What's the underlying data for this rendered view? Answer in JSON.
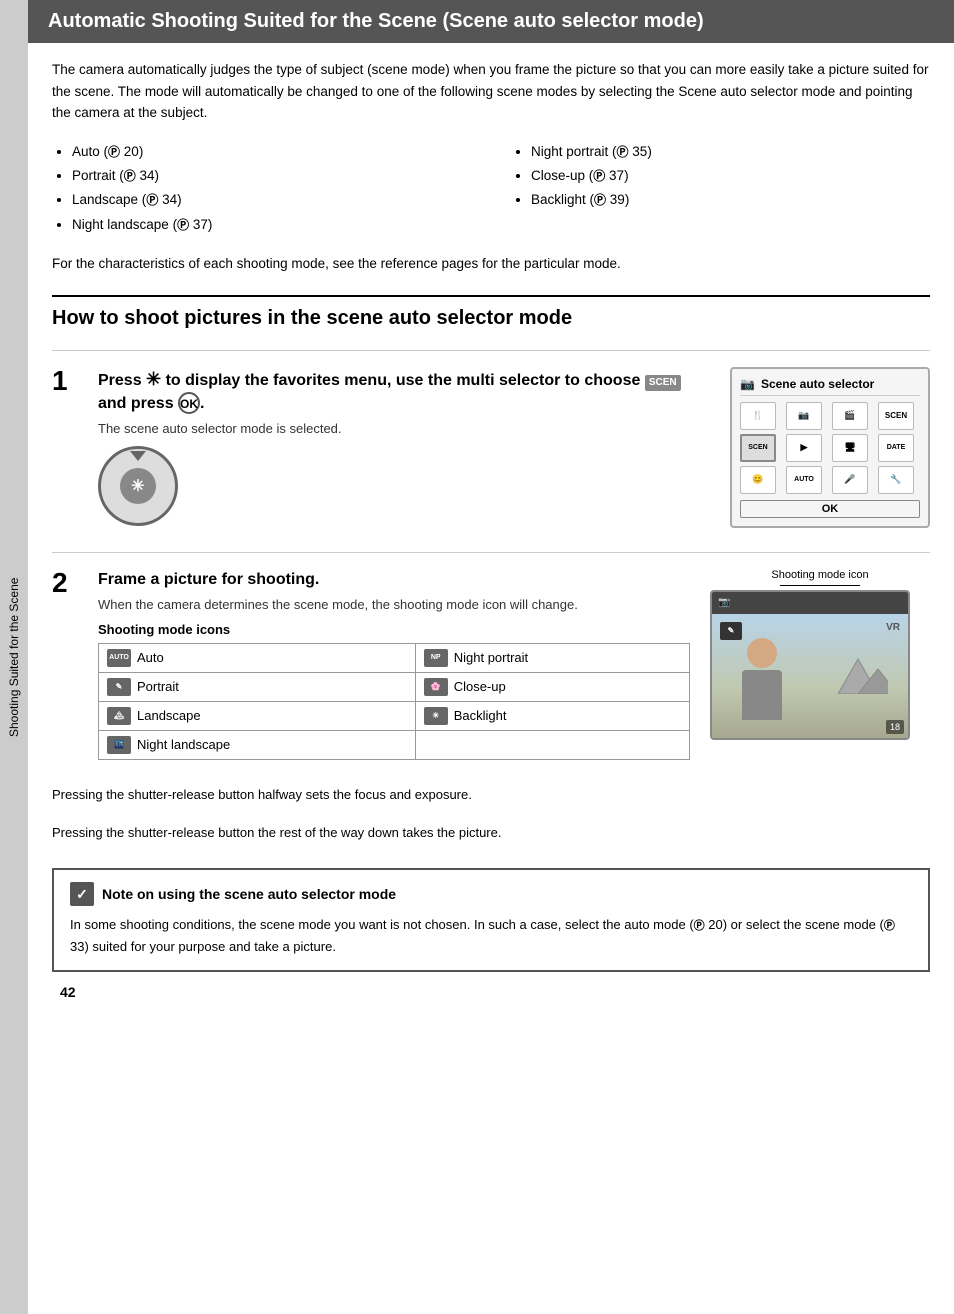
{
  "header": {
    "title": "Automatic Shooting Suited for the Scene (Scene auto selector mode)"
  },
  "intro": {
    "text": "The camera automatically judges the type of subject (scene mode) when you frame the picture so that you can more easily take a picture suited for the scene. The mode will automatically be changed to one of the following scene modes by selecting the Scene auto selector mode and pointing the camera at the subject."
  },
  "bullet_list_left": [
    "Auto (🔎 20)",
    "Portrait (🔎 34)",
    "Landscape (🔎 34)",
    "Night landscape (🔎 37)"
  ],
  "bullet_list_right": [
    "Night portrait (🔎 35)",
    "Close-up (🔎 37)",
    "Backlight (🔎 39)"
  ],
  "ref_text": "For the characteristics of each shooting mode, see the reference pages for the particular mode.",
  "section_heading": "How to shoot pictures in the scene auto selector mode",
  "step1": {
    "number": "1",
    "title": "Press ✳ to display the favorites menu, use the multi selector to choose 🔲 and press ⓪.",
    "desc": "The scene auto selector mode is selected.",
    "menu_title": "Scene auto selector",
    "menu_items": [
      [
        "🍴",
        "📷",
        "🎬",
        "SCEN"
      ],
      [
        "SCEN",
        "▶",
        "🖥",
        "DATE"
      ],
      [
        "😊",
        "AUTO",
        "🎤",
        "🔧"
      ]
    ],
    "ok_label": "OK"
  },
  "step2": {
    "number": "2",
    "title": "Frame a picture for shooting.",
    "desc": "When the camera determines the scene mode, the shooting mode icon will change.",
    "icons_title": "Shooting mode icons",
    "icons": [
      {
        "icon": "AUTO",
        "label": "Auto",
        "icon2": "P",
        "label2": "Night portrait"
      },
      {
        "icon": "✏",
        "label": "Portrait",
        "icon2": "W",
        "label2": "Close-up"
      },
      {
        "icon": "🏔",
        "label": "Landscape",
        "icon2": "☀",
        "label2": "Backlight"
      },
      {
        "icon": "🌃",
        "label": "Night landscape",
        "icon2": "",
        "label2": ""
      }
    ],
    "viewfinder_label": "Shooting mode icon",
    "vr_label": "VR",
    "frame_count": "18"
  },
  "bottom_text1": "Pressing the shutter-release button halfway sets the focus and exposure.",
  "bottom_text2": "Pressing the shutter-release button the rest of the way down takes the picture.",
  "note": {
    "icon": "✓",
    "title": "Note on using the scene auto selector mode",
    "text": "In some shooting conditions, the scene mode you want is not chosen. In such a case, select the auto mode (🔎 20) or select the scene mode (🔎 33) suited for your purpose and take a picture."
  },
  "side_tab": "Shooting Suited for the Scene",
  "page_number": "42",
  "icons_data": {
    "auto": "AUTO",
    "portrait": "✎",
    "landscape": "▣",
    "night_landscape": "🌙",
    "night_portrait": "👤",
    "closeup": "🌸",
    "backlight": "☀"
  }
}
